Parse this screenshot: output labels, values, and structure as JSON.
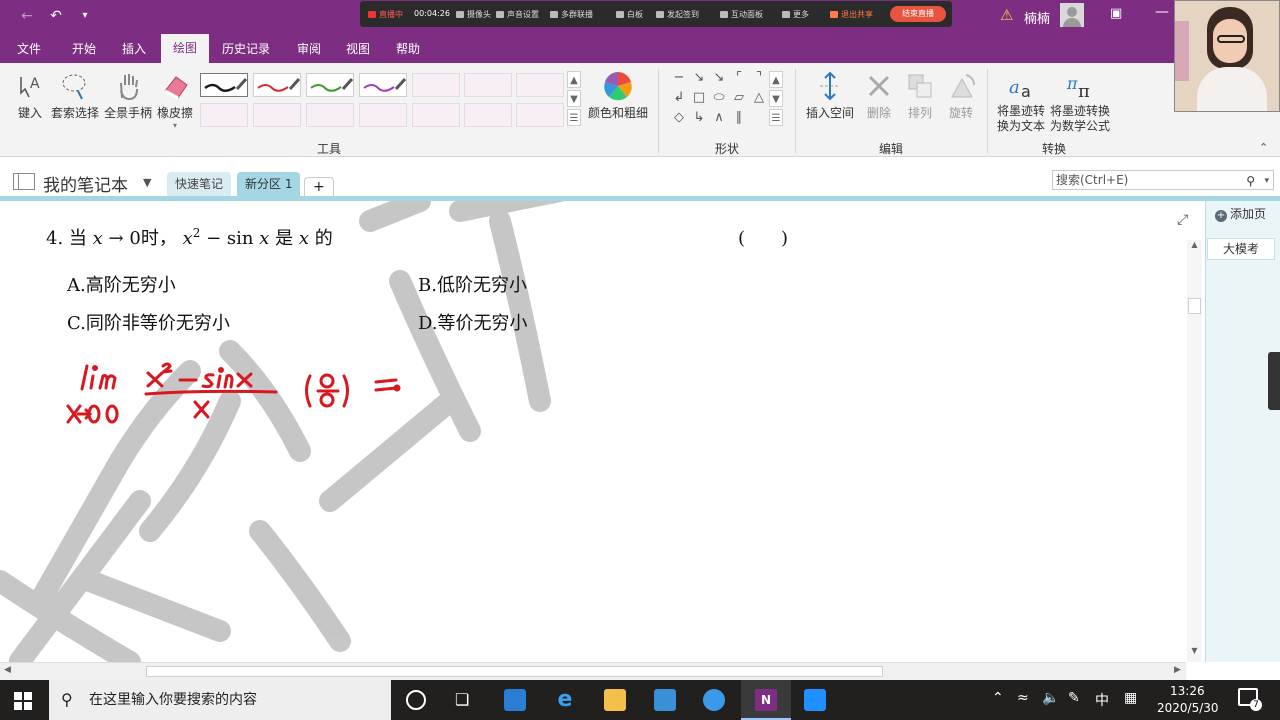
{
  "titlebar": {
    "back_icon": "back-arrow-icon",
    "undo_icon": "undo-icon",
    "customize_icon": "chevron-down-icon",
    "user_name": "楠楠",
    "warning_icon": "warning-icon",
    "ribbon_display_icon": "ribbon-display-icon",
    "minimize_icon": "minimize-icon"
  },
  "live_toolbar": {
    "status": "直播中",
    "timer": "00:04:26",
    "items": [
      "摄像头",
      "声音设置",
      "多群联播",
      "白板",
      "发起签到",
      "互动面板",
      "更多"
    ],
    "exit_share": "退出共享",
    "end_live": "结束直播",
    "accent": "#e9543f"
  },
  "menu": {
    "tabs": [
      "文件",
      "开始",
      "插入",
      "绘图",
      "历史记录",
      "审阅",
      "视图",
      "帮助"
    ],
    "active_tab": "绘图",
    "brand_color": "#7d2e83"
  },
  "ribbon": {
    "tools": [
      "键入",
      "套索选择",
      "全景手柄",
      "橡皮擦"
    ],
    "pens": [
      {
        "color": "#1a1a1a"
      },
      {
        "color": "#d42a2a"
      },
      {
        "color": "#3a9a2a"
      },
      {
        "color": "#a33ac7"
      }
    ],
    "color_width_label": "颜色和粗细",
    "group_tools": "工具",
    "group_shapes": "形状",
    "edit_buttons": [
      "插入空间",
      "删除",
      "排列",
      "旋转"
    ],
    "group_edit": "编辑",
    "convert_buttons": [
      "将墨迹转换为文本",
      "将墨迹转换为数学公式"
    ],
    "convert_lines": [
      "将墨迹转",
      "换为文本",
      "将墨迹转换",
      "为数学公式"
    ],
    "group_convert": "转换"
  },
  "notebook": {
    "title": "我的笔记本",
    "sections": [
      "快速笔记",
      "新分区 1"
    ],
    "add_section": "+",
    "search_placeholder": "搜索(Ctrl+E)"
  },
  "page_pane": {
    "add_page": "添加页",
    "pages": [
      "大模考"
    ]
  },
  "question": {
    "number": "4.",
    "stem_prefix": "当",
    "var": "x",
    "arrow": "→",
    "zero": "0",
    "when": "时，",
    "expr": "x",
    "sup": "2",
    "minus_sin": "− sin",
    "expr_x": "x",
    "is": "是",
    "of": "的",
    "paren": "(　　)",
    "options": [
      "A.高阶无穷小",
      "B.低阶无穷小",
      "C.同阶非等价无穷小",
      "D.等价无穷小"
    ]
  },
  "handwriting": {
    "lines": [
      "lim",
      "x→0",
      "x²−sinx",
      "x",
      "(0/0)",
      "="
    ],
    "ink_color": "#d9171f"
  },
  "taskbar": {
    "search_text": "在这里输入你要搜索的内容",
    "ime": "中",
    "time": "13:26",
    "date": "2020/5/30",
    "notification_count": "7"
  }
}
